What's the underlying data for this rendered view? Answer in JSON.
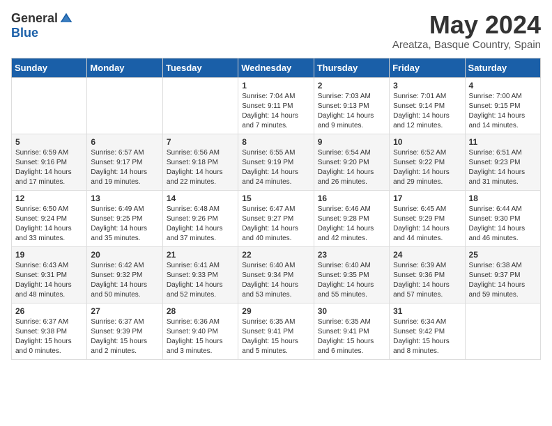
{
  "logo": {
    "general": "General",
    "blue": "Blue"
  },
  "title": {
    "month_year": "May 2024",
    "location": "Areatza, Basque Country, Spain"
  },
  "headers": [
    "Sunday",
    "Monday",
    "Tuesday",
    "Wednesday",
    "Thursday",
    "Friday",
    "Saturday"
  ],
  "weeks": [
    [
      {
        "day": "",
        "info": ""
      },
      {
        "day": "",
        "info": ""
      },
      {
        "day": "",
        "info": ""
      },
      {
        "day": "1",
        "info": "Sunrise: 7:04 AM\nSunset: 9:11 PM\nDaylight: 14 hours\nand 7 minutes."
      },
      {
        "day": "2",
        "info": "Sunrise: 7:03 AM\nSunset: 9:13 PM\nDaylight: 14 hours\nand 9 minutes."
      },
      {
        "day": "3",
        "info": "Sunrise: 7:01 AM\nSunset: 9:14 PM\nDaylight: 14 hours\nand 12 minutes."
      },
      {
        "day": "4",
        "info": "Sunrise: 7:00 AM\nSunset: 9:15 PM\nDaylight: 14 hours\nand 14 minutes."
      }
    ],
    [
      {
        "day": "5",
        "info": "Sunrise: 6:59 AM\nSunset: 9:16 PM\nDaylight: 14 hours\nand 17 minutes."
      },
      {
        "day": "6",
        "info": "Sunrise: 6:57 AM\nSunset: 9:17 PM\nDaylight: 14 hours\nand 19 minutes."
      },
      {
        "day": "7",
        "info": "Sunrise: 6:56 AM\nSunset: 9:18 PM\nDaylight: 14 hours\nand 22 minutes."
      },
      {
        "day": "8",
        "info": "Sunrise: 6:55 AM\nSunset: 9:19 PM\nDaylight: 14 hours\nand 24 minutes."
      },
      {
        "day": "9",
        "info": "Sunrise: 6:54 AM\nSunset: 9:20 PM\nDaylight: 14 hours\nand 26 minutes."
      },
      {
        "day": "10",
        "info": "Sunrise: 6:52 AM\nSunset: 9:22 PM\nDaylight: 14 hours\nand 29 minutes."
      },
      {
        "day": "11",
        "info": "Sunrise: 6:51 AM\nSunset: 9:23 PM\nDaylight: 14 hours\nand 31 minutes."
      }
    ],
    [
      {
        "day": "12",
        "info": "Sunrise: 6:50 AM\nSunset: 9:24 PM\nDaylight: 14 hours\nand 33 minutes."
      },
      {
        "day": "13",
        "info": "Sunrise: 6:49 AM\nSunset: 9:25 PM\nDaylight: 14 hours\nand 35 minutes."
      },
      {
        "day": "14",
        "info": "Sunrise: 6:48 AM\nSunset: 9:26 PM\nDaylight: 14 hours\nand 37 minutes."
      },
      {
        "day": "15",
        "info": "Sunrise: 6:47 AM\nSunset: 9:27 PM\nDaylight: 14 hours\nand 40 minutes."
      },
      {
        "day": "16",
        "info": "Sunrise: 6:46 AM\nSunset: 9:28 PM\nDaylight: 14 hours\nand 42 minutes."
      },
      {
        "day": "17",
        "info": "Sunrise: 6:45 AM\nSunset: 9:29 PM\nDaylight: 14 hours\nand 44 minutes."
      },
      {
        "day": "18",
        "info": "Sunrise: 6:44 AM\nSunset: 9:30 PM\nDaylight: 14 hours\nand 46 minutes."
      }
    ],
    [
      {
        "day": "19",
        "info": "Sunrise: 6:43 AM\nSunset: 9:31 PM\nDaylight: 14 hours\nand 48 minutes."
      },
      {
        "day": "20",
        "info": "Sunrise: 6:42 AM\nSunset: 9:32 PM\nDaylight: 14 hours\nand 50 minutes."
      },
      {
        "day": "21",
        "info": "Sunrise: 6:41 AM\nSunset: 9:33 PM\nDaylight: 14 hours\nand 52 minutes."
      },
      {
        "day": "22",
        "info": "Sunrise: 6:40 AM\nSunset: 9:34 PM\nDaylight: 14 hours\nand 53 minutes."
      },
      {
        "day": "23",
        "info": "Sunrise: 6:40 AM\nSunset: 9:35 PM\nDaylight: 14 hours\nand 55 minutes."
      },
      {
        "day": "24",
        "info": "Sunrise: 6:39 AM\nSunset: 9:36 PM\nDaylight: 14 hours\nand 57 minutes."
      },
      {
        "day": "25",
        "info": "Sunrise: 6:38 AM\nSunset: 9:37 PM\nDaylight: 14 hours\nand 59 minutes."
      }
    ],
    [
      {
        "day": "26",
        "info": "Sunrise: 6:37 AM\nSunset: 9:38 PM\nDaylight: 15 hours\nand 0 minutes."
      },
      {
        "day": "27",
        "info": "Sunrise: 6:37 AM\nSunset: 9:39 PM\nDaylight: 15 hours\nand 2 minutes."
      },
      {
        "day": "28",
        "info": "Sunrise: 6:36 AM\nSunset: 9:40 PM\nDaylight: 15 hours\nand 3 minutes."
      },
      {
        "day": "29",
        "info": "Sunrise: 6:35 AM\nSunset: 9:41 PM\nDaylight: 15 hours\nand 5 minutes."
      },
      {
        "day": "30",
        "info": "Sunrise: 6:35 AM\nSunset: 9:41 PM\nDaylight: 15 hours\nand 6 minutes."
      },
      {
        "day": "31",
        "info": "Sunrise: 6:34 AM\nSunset: 9:42 PM\nDaylight: 15 hours\nand 8 minutes."
      },
      {
        "day": "",
        "info": ""
      }
    ]
  ]
}
